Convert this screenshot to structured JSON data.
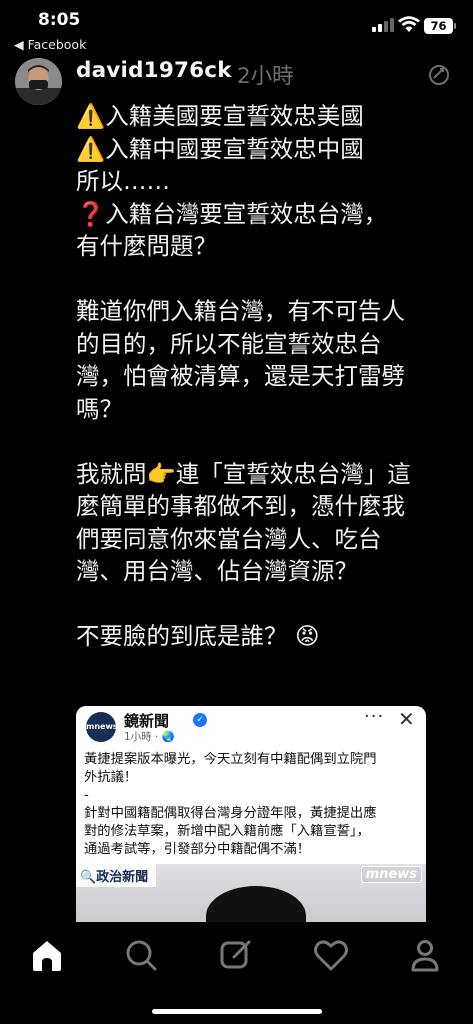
{
  "status_bar": {
    "time": "8:05",
    "back_label": "◀ Facebook",
    "battery": "76"
  },
  "post": {
    "username": "david1976ck",
    "time": "2小時",
    "lines": [
      "⚠️入籍美國要宣誓效忠美國",
      "⚠️入籍中國要宣誓效忠中國",
      "所以……",
      "❓入籍台灣要宣誓效忠台灣，",
      "有什麼問題？",
      "",
      "難道你們入籍台灣，有不可告人",
      "的目的，所以不能宣誓效忠台",
      "灣，怕會被清算，還是天打雷劈",
      "嗎？",
      "",
      "我就問👉連「宣誓效忠台灣」這",
      "麼簡單的事都做不到，憑什麼我",
      "們要同意你來當台灣人、吃台",
      "灣、用台灣、佔台灣資源？",
      "",
      "不要臉的到底是誰？ 😡"
    ]
  },
  "embed": {
    "logo_text": "mnews",
    "page_name": "鏡新聞",
    "verified_mark": "✓",
    "time": "1小時 · 🌏",
    "more": "···",
    "close": "✕",
    "text_lines": [
      "黃捷提案版本曝光，今天立刻有中籍配偶到立院門",
      "外抗議！",
      "-",
      "針對中國籍配偶取得台灣身分證年限，黃捷提出應",
      "對的修法草案，新增中配入籍前應「入籍宣誓」，",
      "通過考試等，引發部分中籍配偶不滿！"
    ],
    "tag_left": "🔍政治新聞",
    "tag_right": "mnews"
  },
  "nav": {
    "items": [
      "home-icon",
      "search-icon",
      "compose-icon",
      "heart-icon",
      "profile-icon"
    ]
  },
  "colors": {
    "background": "#000000",
    "text": "#f2f2f2",
    "muted": "#6e6e6e"
  }
}
